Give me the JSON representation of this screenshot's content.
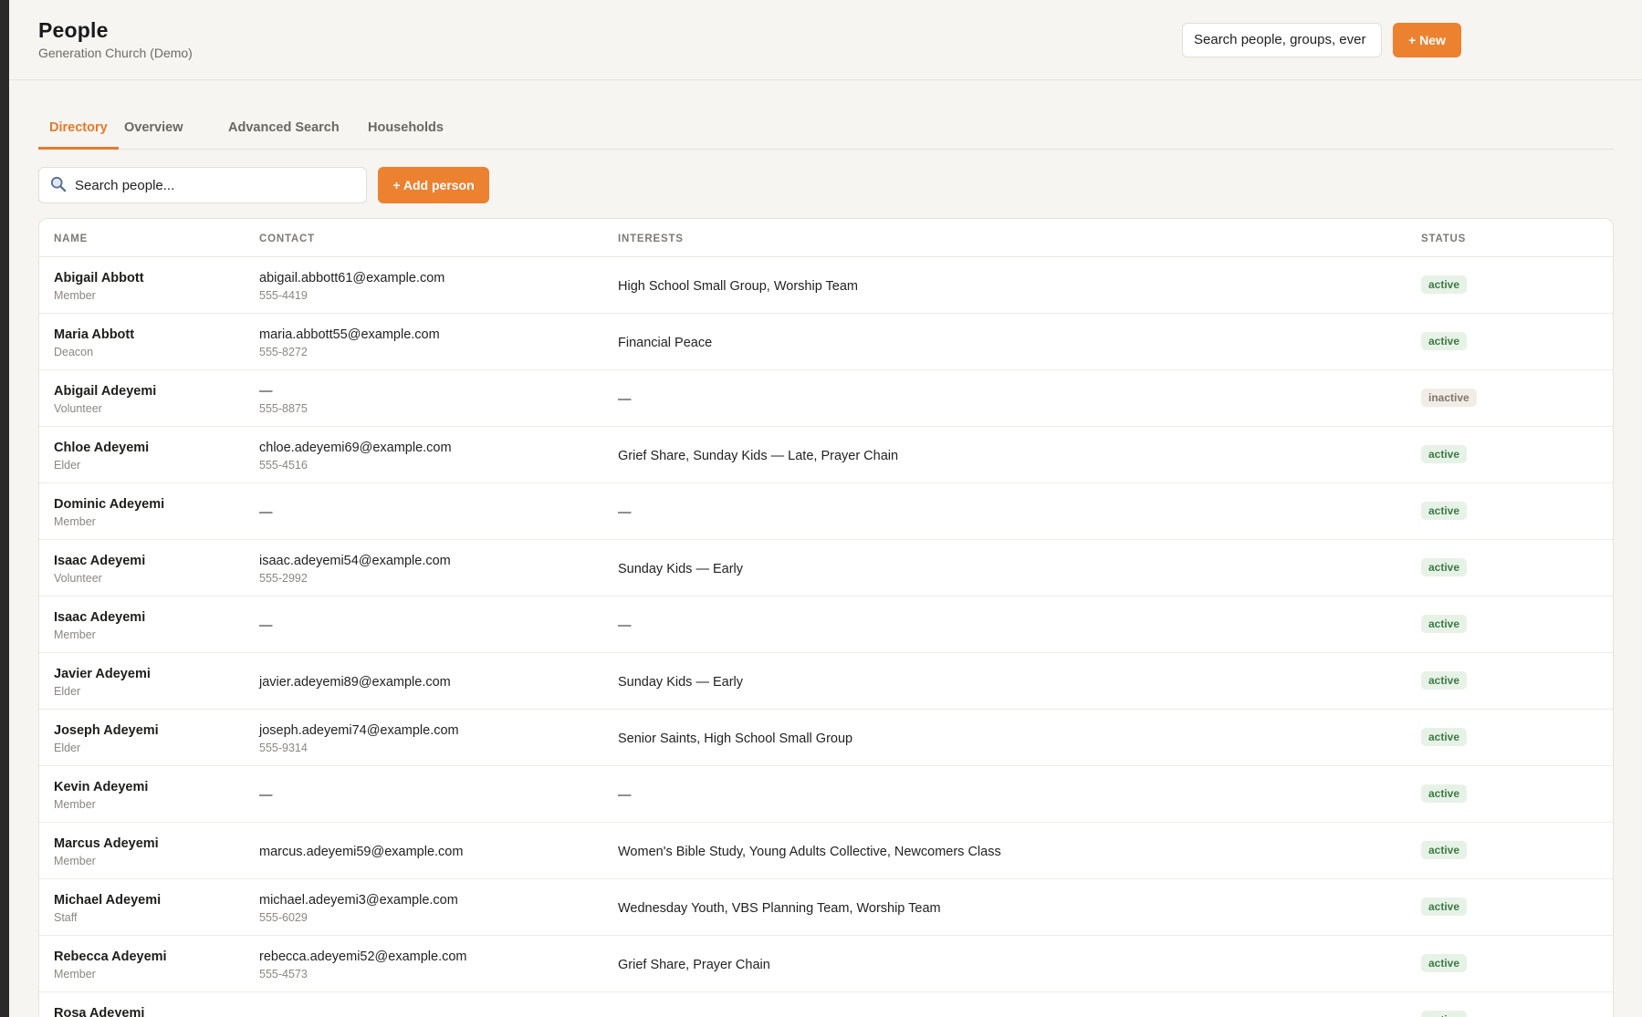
{
  "header": {
    "title": "People",
    "subtitle": "Generation Church (Demo)",
    "global_search_value": "Search people, groups, ever",
    "new_label": "+ New"
  },
  "tabs": [
    {
      "label": "Directory",
      "active": true
    },
    {
      "label": "Overview",
      "active": false
    },
    {
      "label": "Advanced Search",
      "active": false
    },
    {
      "label": "Households",
      "active": false
    }
  ],
  "toolbar": {
    "search_placeholder": "Search people...",
    "add_label": "+ Add person",
    "search_icon": "magnifier-icon"
  },
  "table": {
    "columns": [
      "NAME",
      "CONTACT",
      "INTERESTS",
      "STATUS"
    ],
    "rows": [
      {
        "name": "Abigail Abbott",
        "role": "Member",
        "email": "abigail.abbott61@example.com",
        "phone": "555-4419",
        "interests": "High School Small Group, Worship Team",
        "status": "active"
      },
      {
        "name": "Maria Abbott",
        "role": "Deacon",
        "email": "maria.abbott55@example.com",
        "phone": "555-8272",
        "interests": "Financial Peace",
        "status": "active"
      },
      {
        "name": "Abigail Adeyemi",
        "role": "Volunteer",
        "email": "—",
        "phone": "555-8875",
        "interests": "—",
        "status": "inactive"
      },
      {
        "name": "Chloe Adeyemi",
        "role": "Elder",
        "email": "chloe.adeyemi69@example.com",
        "phone": "555-4516",
        "interests": "Grief Share, Sunday Kids — Late, Prayer Chain",
        "status": "active"
      },
      {
        "name": "Dominic Adeyemi",
        "role": "Member",
        "email": "—",
        "phone": "",
        "interests": "—",
        "status": "active"
      },
      {
        "name": "Isaac Adeyemi",
        "role": "Volunteer",
        "email": "isaac.adeyemi54@example.com",
        "phone": "555-2992",
        "interests": "Sunday Kids — Early",
        "status": "active"
      },
      {
        "name": "Isaac Adeyemi",
        "role": "Member",
        "email": "—",
        "phone": "",
        "interests": "—",
        "status": "active"
      },
      {
        "name": "Javier Adeyemi",
        "role": "Elder",
        "email": "javier.adeyemi89@example.com",
        "phone": "",
        "interests": "Sunday Kids — Early",
        "status": "active"
      },
      {
        "name": "Joseph Adeyemi",
        "role": "Elder",
        "email": "joseph.adeyemi74@example.com",
        "phone": "555-9314",
        "interests": "Senior Saints, High School Small Group",
        "status": "active"
      },
      {
        "name": "Kevin Adeyemi",
        "role": "Member",
        "email": "—",
        "phone": "",
        "interests": "—",
        "status": "active"
      },
      {
        "name": "Marcus Adeyemi",
        "role": "Member",
        "email": "marcus.adeyemi59@example.com",
        "phone": "",
        "interests": "Women's Bible Study, Young Adults Collective, Newcomers Class",
        "status": "active"
      },
      {
        "name": "Michael Adeyemi",
        "role": "Staff",
        "email": "michael.adeyemi3@example.com",
        "phone": "555-6029",
        "interests": "Wednesday Youth, VBS Planning Team, Worship Team",
        "status": "active"
      },
      {
        "name": "Rebecca Adeyemi",
        "role": "Member",
        "email": "rebecca.adeyemi52@example.com",
        "phone": "555-4573",
        "interests": "Grief Share, Prayer Chain",
        "status": "active"
      },
      {
        "name": "Rosa Adeyemi",
        "role": "",
        "email": "",
        "phone": "",
        "interests": "",
        "status": "active"
      }
    ]
  },
  "colors": {
    "accent": "#ec8130",
    "active_bg": "#e7f2e7",
    "active_text": "#3d7a46",
    "inactive_bg": "#f1ede6",
    "inactive_text": "#7f776c",
    "page_bg": "#f6f5f2"
  }
}
